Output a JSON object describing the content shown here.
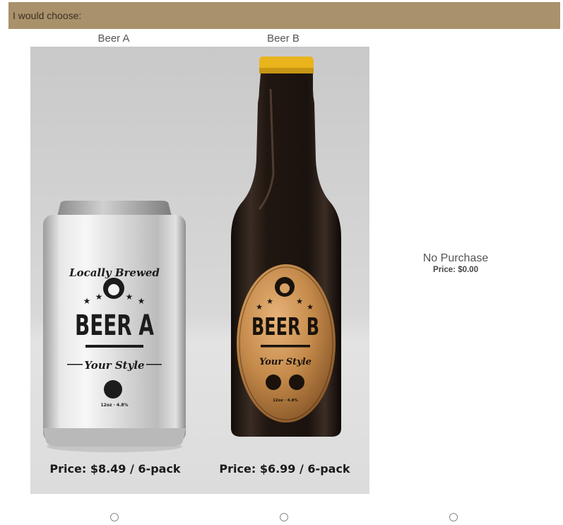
{
  "header": {
    "prompt": "I would choose:"
  },
  "options": [
    {
      "label": "Beer A",
      "price": "Price: $8.49 / 6-pack",
      "label_top": "Locally Brewed",
      "brand": "BEER A",
      "style": "Your Style",
      "fine_print": "12oz · 4.8%"
    },
    {
      "label": "Beer B",
      "price": "Price: $6.99 / 6-pack",
      "brand": "BEER B",
      "style": "Your Style",
      "fine_print": "12oz · 4.8%"
    }
  ],
  "no_purchase": {
    "label": "No Purchase",
    "price": "Price: $0.00"
  },
  "colors": {
    "header_bg": "#a9916b",
    "panel_bg": "#d4d4d4",
    "bottle_cap": "#e9b41c",
    "label_gold": "#c89352"
  }
}
